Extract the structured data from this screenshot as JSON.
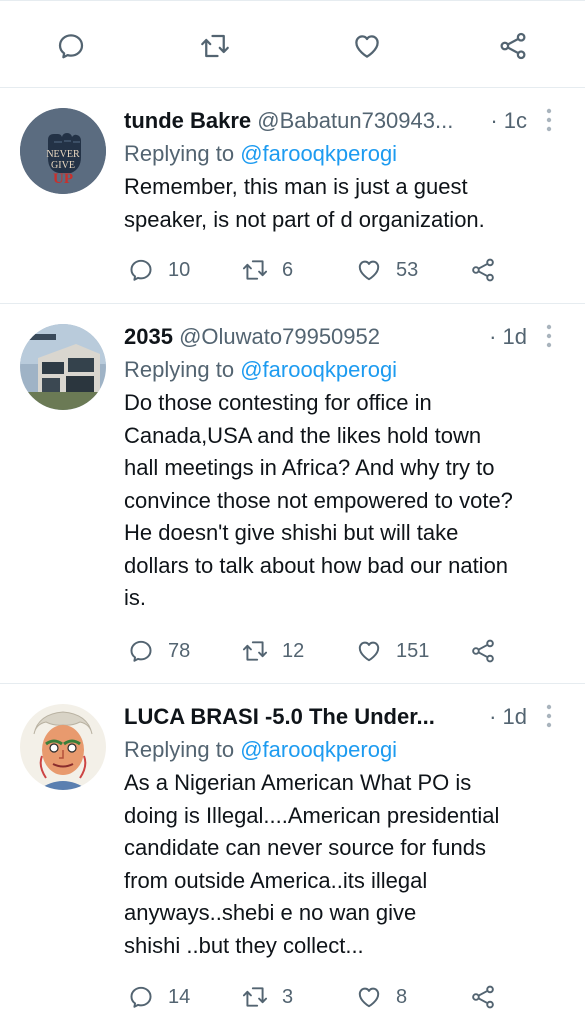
{
  "colors": {
    "accent": "#1d9bf0",
    "text": "#0f1419",
    "secondary": "#536471",
    "divider": "#e6ecf0"
  },
  "top_actions": [
    "reply-icon",
    "retweet-icon",
    "like-icon",
    "share-icon"
  ],
  "tweets": [
    {
      "name": "tunde Bakre",
      "handle": "@Babatun730943...",
      "time": "· 1c",
      "reply_prefix": "Replying to",
      "reply_to": "@farooqkperogi",
      "lines": [
        "Remember, this man is just a guest",
        "speaker, is not part of d organization."
      ],
      "replies": "10",
      "retweets": "6",
      "likes": "53",
      "avatar": "fist-avatar",
      "avatar_text": [
        "NEVER",
        "GIVE",
        "UP"
      ]
    },
    {
      "name": "2035",
      "handle": "@Oluwato79950952",
      "time": "· 1d",
      "reply_prefix": "Replying to",
      "reply_to": "@farooqkperogi",
      "lines": [
        "Do those contesting for office in",
        "Canada,USA and the likes hold town",
        "hall meetings in Africa? And why try to",
        "convince those not empowered to vote?",
        "He doesn't give shishi but will take",
        "dollars to talk about how bad our nation",
        "is."
      ],
      "replies": "78",
      "retweets": "12",
      "likes": "151",
      "avatar": "house-avatar"
    },
    {
      "name": "LUCA BRASI -5.0 The Under...",
      "handle": "",
      "time": "· 1d",
      "reply_prefix": "Replying to",
      "reply_to": "@farooqkperogi",
      "lines": [
        "As a Nigerian American What PO is",
        "doing is Illegal....American presidential",
        "candidate can never source for funds",
        "from outside America..its illegal",
        "anyways..shebi e no wan give",
        "shishi ..but they collect..."
      ],
      "replies": "14",
      "retweets": "3",
      "likes": "8",
      "avatar": "portrait-avatar"
    }
  ]
}
